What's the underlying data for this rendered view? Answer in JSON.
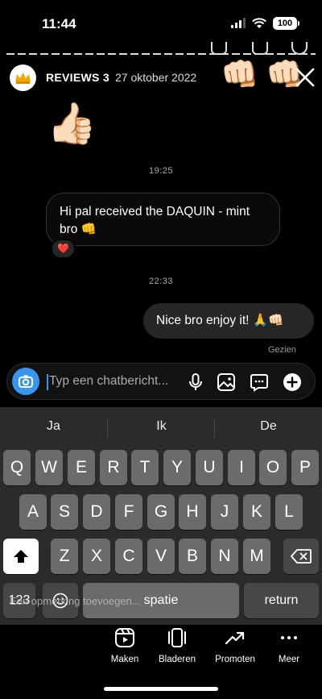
{
  "status_bar": {
    "time": "11:44",
    "battery": "100"
  },
  "header": {
    "account_name": "REVIEWS 3",
    "date": "27 oktober 2022"
  },
  "chat": {
    "timestamp_1": "19:25",
    "incoming_message": "Hi pal received the DAQUIN - mint bro 👊",
    "reaction": "❤️",
    "timestamp_2": "22:33",
    "outgoing_message": "Nice bro enjoy it! 🙏👊🏻",
    "seen_label": "Gezien"
  },
  "composer": {
    "placeholder": "Typ een chatbericht..."
  },
  "keyboard": {
    "suggestions": [
      "Ja",
      "Ik",
      "De"
    ],
    "row1": [
      "Q",
      "W",
      "E",
      "R",
      "T",
      "Y",
      "U",
      "I",
      "O",
      "P"
    ],
    "row2": [
      "A",
      "S",
      "D",
      "F",
      "G",
      "H",
      "J",
      "K",
      "L"
    ],
    "row3": [
      "Z",
      "X",
      "C",
      "V",
      "B",
      "N",
      "M"
    ],
    "numbers_label": "123",
    "space_label": "spatie",
    "return_label": "return",
    "caption_overlay": "Een opmerking toevoegen..."
  },
  "actions": [
    {
      "label": "Maken",
      "icon": "reels-icon"
    },
    {
      "label": "Bladeren",
      "icon": "carousel-icon"
    },
    {
      "label": "Promoten",
      "icon": "trending-up-icon"
    },
    {
      "label": "Meer",
      "icon": "more-dots-icon"
    }
  ]
}
